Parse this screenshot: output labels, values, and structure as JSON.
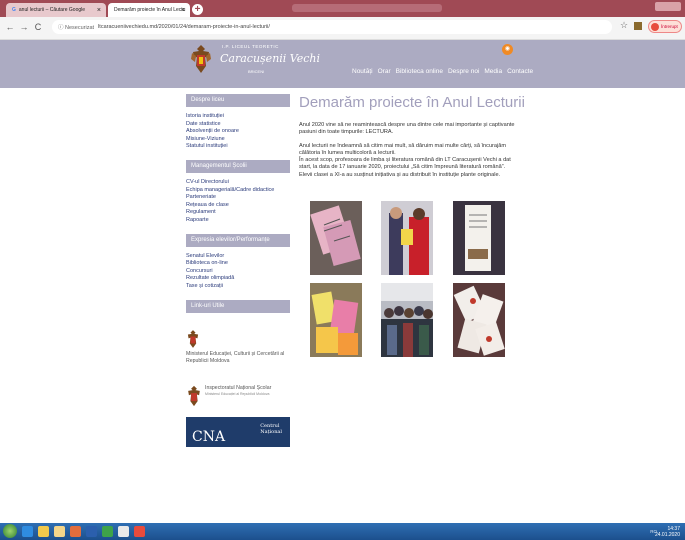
{
  "browser": {
    "tabs": [
      {
        "label": "anul lecturii – Căutare Google"
      },
      {
        "label": "Demarăm proiecte în Anul Lectu"
      }
    ],
    "new_tab": "+",
    "close_glyph": "×",
    "security_label": "ⓘ Nesecurizat",
    "url": "ltcaracueniivechiedu.md/2020/01/24/demaram-proiecte-in-anul-lecturii/",
    "profile_label": "Întrerupt"
  },
  "site": {
    "school_prefix": "I.P. LICEUL TEORETIC",
    "school_name": "Caracușenii Vechi",
    "school_place": "BRICENI",
    "nav": [
      "Noutăți",
      "Orar",
      "Biblioteca online",
      "Despre noi",
      "Media",
      "Contacte"
    ]
  },
  "sidebar": {
    "sections": [
      {
        "title": "Despre liceu",
        "items": [
          "Istoria instituției",
          "Date statistice",
          "Absolvenții de onoare",
          "Misiune-Viziune",
          "Statutul instituției"
        ]
      },
      {
        "title": "Managementul Școlii",
        "items": [
          "CV-ul Directorului",
          "Echipa managerială/Cadre didactice",
          "Parteneriate",
          "Rețeaua de clase",
          "Regulament",
          "Rapoarte"
        ]
      },
      {
        "title": "Expresia elevilor/Performanțe",
        "items": [
          "Senatul Elevilor",
          "Biblioteca on-line",
          "Concursuri",
          "Rezultate olimpiadă",
          "Taxe și cotizații"
        ]
      },
      {
        "title": "Link-uri Utile",
        "items": []
      }
    ],
    "partners": [
      {
        "label": "Ministerul Educației, Culturii și Cercetării al Republicii Moldova",
        "sub": ""
      },
      {
        "label": "Inspectoratul Național Școlar",
        "sub": "Ministerul Educației al Republicii Moldova"
      }
    ],
    "cna": {
      "big": "CNA",
      "small_1": "Centrul",
      "small_2": "Național"
    }
  },
  "article": {
    "title": "Demarăm proiecte în Anul Lecturii",
    "paragraphs": [
      "Anul 2020 vine să ne reamintească despre una dintre cele mai importante și captivante pasiuni din toate timpurile: LECTURA.",
      "Anul lecturii ne îndeamnă să citim mai mult, să dăruim mai multe cărți, să încurajăm călătoria în lumea multicoloră a lecturii.",
      "În acest scop, profesoara de limba și literatura română din LT Caracușenii Vechi a dat start, la data de 17 ianuarie 2020, proiectului „Să citim împreună literatură română”.",
      "Elevii clasei a XI-a au susținut inițiativa și au distribuit în instituție plante originale."
    ]
  },
  "taskbar": {
    "time": "14:37",
    "date": "24.01.2020",
    "tray": "RO"
  },
  "icons": [
    "back-icon",
    "forward-icon",
    "reload-icon",
    "star-icon",
    "rss-icon",
    "crest-icon",
    "start-icon"
  ],
  "colors": {
    "header": "#acabc2",
    "title": "#a29fbc",
    "tabbar": "#a04a55",
    "link": "#2a3a7a"
  }
}
